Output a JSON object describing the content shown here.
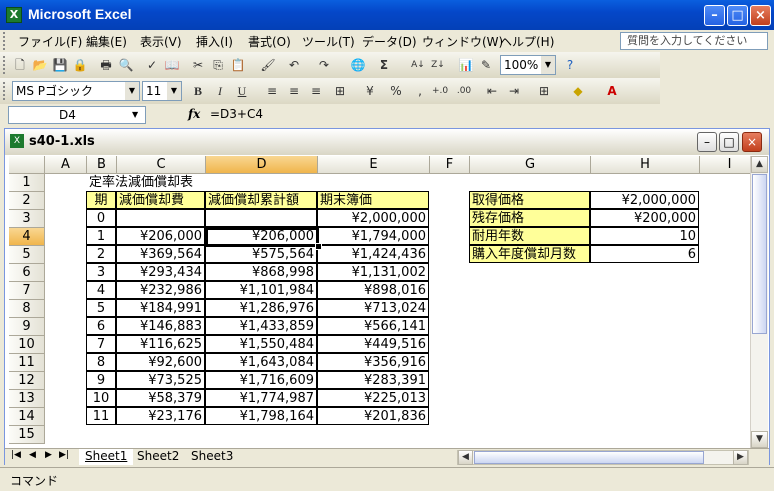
{
  "app": {
    "title": "Microsoft Excel"
  },
  "menu": {
    "items": [
      "ファイル(F)",
      "編集(E)",
      "表示(V)",
      "挿入(I)",
      "書式(O)",
      "ツール(T)",
      "データ(D)",
      "ウィンドウ(W)",
      "ヘルプ(H)"
    ],
    "help_placeholder": "質問を入力してください"
  },
  "toolbar": {
    "zoom": "100%",
    "font_name": "MS Pゴシック",
    "font_size": "11",
    "bold": "B",
    "italic": "I",
    "underline": "U"
  },
  "formula_bar": {
    "name_box": "D4",
    "fx_label": "fx",
    "formula": "=D3+C4"
  },
  "workbook": {
    "title": "s40-1.xls",
    "columns": [
      "A",
      "B",
      "C",
      "D",
      "E",
      "F",
      "G",
      "H",
      "I"
    ],
    "rows": [
      "1",
      "2",
      "3",
      "4",
      "5",
      "6",
      "7",
      "8",
      "9",
      "10",
      "11",
      "12",
      "13",
      "14",
      "15"
    ],
    "selected_cell": "D4",
    "table_title": "定率法減価償却表",
    "table_headers": [
      "期",
      "減価償却費",
      "減価償却累計額",
      "期末簿価"
    ],
    "table_rows": [
      [
        "0",
        "",
        "",
        "¥2,000,000"
      ],
      [
        "1",
        "¥206,000",
        "¥206,000",
        "¥1,794,000"
      ],
      [
        "2",
        "¥369,564",
        "¥575,564",
        "¥1,424,436"
      ],
      [
        "3",
        "¥293,434",
        "¥868,998",
        "¥1,131,002"
      ],
      [
        "4",
        "¥232,986",
        "¥1,101,984",
        "¥898,016"
      ],
      [
        "5",
        "¥184,991",
        "¥1,286,976",
        "¥713,024"
      ],
      [
        "6",
        "¥146,883",
        "¥1,433,859",
        "¥566,141"
      ],
      [
        "7",
        "¥116,625",
        "¥1,550,484",
        "¥449,516"
      ],
      [
        "8",
        "¥92,600",
        "¥1,643,084",
        "¥356,916"
      ],
      [
        "9",
        "¥73,525",
        "¥1,716,609",
        "¥283,391"
      ],
      [
        "10",
        "¥58,379",
        "¥1,774,987",
        "¥225,013"
      ],
      [
        "11",
        "¥23,176",
        "¥1,798,164",
        "¥201,836"
      ]
    ],
    "params": [
      {
        "label": "取得価格",
        "value": "¥2,000,000"
      },
      {
        "label": "残存価格",
        "value": "¥200,000"
      },
      {
        "label": "耐用年数",
        "value": "10"
      },
      {
        "label": "購入年度償却月数",
        "value": "6"
      }
    ],
    "sheets": [
      "Sheet1",
      "Sheet2",
      "Sheet3"
    ],
    "active_sheet": "Sheet1"
  },
  "status": {
    "text": "コマンド"
  },
  "colors": {
    "header_fill": "#ffff99",
    "title_bar": "#0447c9",
    "selected_header": "#f0b54c"
  }
}
